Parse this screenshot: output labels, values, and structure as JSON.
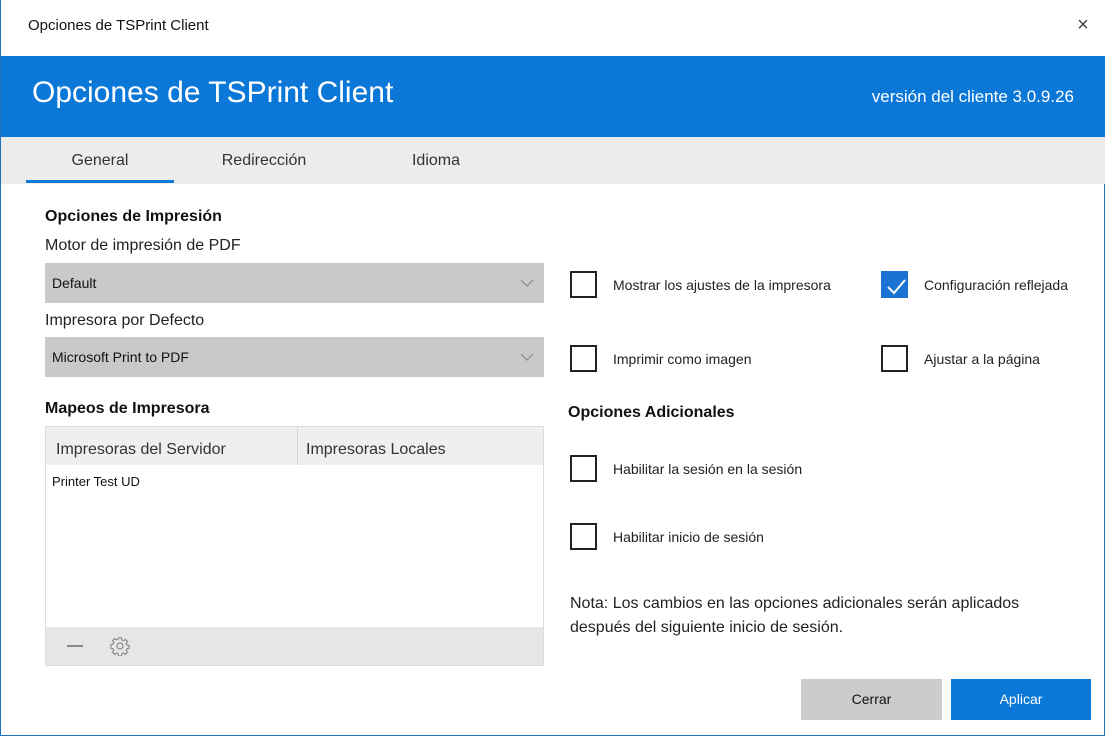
{
  "window": {
    "title": "Opciones de TSPrint Client",
    "close_glyph": "×"
  },
  "header": {
    "title": "Opciones de TSPrint Client",
    "version": "versión del cliente 3.0.9.26",
    "accent": "#0b78d7"
  },
  "tabs": [
    {
      "label": "General",
      "active": true
    },
    {
      "label": "Redirección",
      "active": false
    },
    {
      "label": "Idioma",
      "active": false
    }
  ],
  "print_options": {
    "title": "Opciones de Impresión",
    "pdf_engine_label": "Motor de impresión de PDF",
    "pdf_engine_value": "Default",
    "default_printer_label": "Impresora por Defecto",
    "default_printer_value": "Microsoft Print to PDF"
  },
  "printer_mappings": {
    "title": "Mapeos de Impresora",
    "columns": [
      "Impresoras del Servidor",
      "Impresoras Locales"
    ],
    "rows": [
      {
        "server": "Printer Test UD",
        "local": ""
      }
    ],
    "footer_icons": [
      "minus-icon",
      "gear-icon"
    ]
  },
  "checkboxes": {
    "show_printer_settings": {
      "label": "Mostrar los ajustes de la impresora",
      "checked": false
    },
    "mirrored_config": {
      "label": "Configuración reflejada",
      "checked": true
    },
    "print_as_image": {
      "label": "Imprimir como imagen",
      "checked": false
    },
    "fit_to_page": {
      "label": "Ajustar a la página",
      "checked": false
    }
  },
  "additional_options": {
    "title": "Opciones Adicionales",
    "session_in_session": {
      "label": "Habilitar la sesión en la sesión",
      "checked": false
    },
    "enable_login": {
      "label": "Habilitar inicio de sesión",
      "checked": false
    },
    "note": "Nota: Los cambios en las opciones adicionales serán aplicados después del siguiente inicio de sesión."
  },
  "buttons": {
    "close": "Cerrar",
    "apply": "Aplicar"
  }
}
